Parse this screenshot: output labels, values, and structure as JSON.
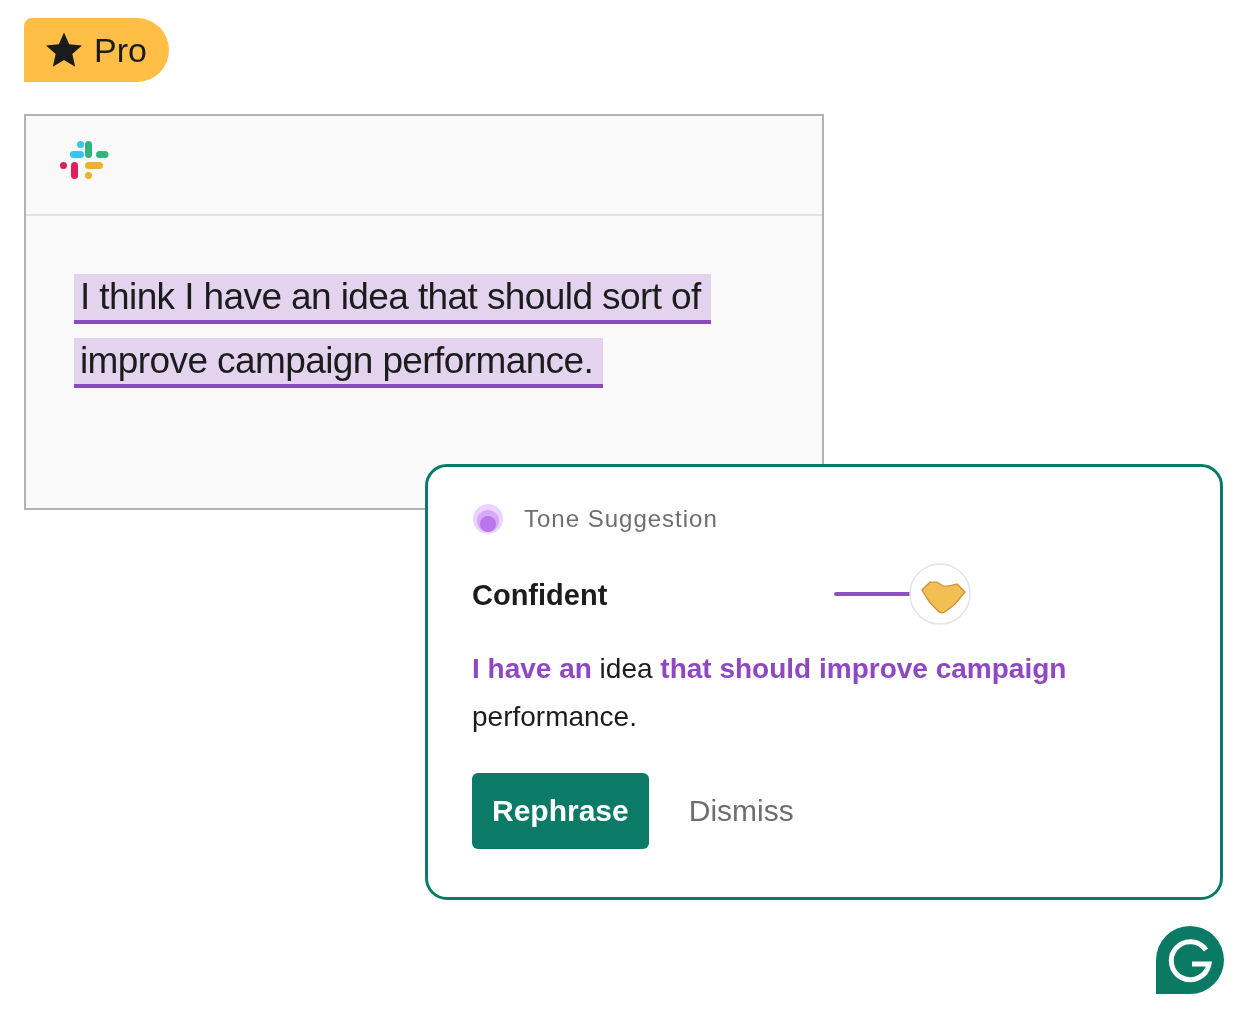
{
  "badge": {
    "label": "Pro"
  },
  "message": {
    "lines": [
      "I think I have an idea that should sort of",
      "improve campaign performance."
    ]
  },
  "suggestion": {
    "category": "Tone Suggestion",
    "tone": "Confident",
    "text": "**I have an** idea **that should improve campaign** performance.",
    "buttons": [
      {
        "label": "Rephrase",
        "kind": "primary"
      },
      {
        "label": "Dismiss",
        "kind": "plain"
      }
    ]
  }
}
